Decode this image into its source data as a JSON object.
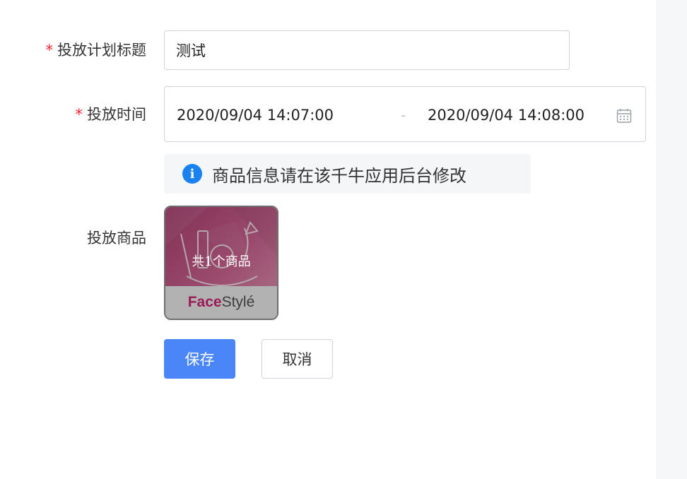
{
  "form": {
    "title_field": {
      "required_mark": "*",
      "label": "投放计划标题",
      "value": "测试"
    },
    "time_field": {
      "required_mark": "*",
      "label": "投放时间",
      "start": "2020/09/04 14:07:00",
      "separator": "-",
      "end": "2020/09/04 14:08:00"
    },
    "notice": {
      "icon_char": "i",
      "text": "商品信息请在该千牛应用后台修改"
    },
    "products_field": {
      "label": "投放商品",
      "count_text": "共1个商品",
      "brand_part1": "Face",
      "brand_part2": "Stylé"
    }
  },
  "actions": {
    "save_label": "保存",
    "cancel_label": "取消"
  },
  "icons": {
    "calendar": "calendar-icon",
    "info": "info-icon"
  },
  "colors": {
    "primary": "#4a86f7",
    "required": "#f5222d",
    "info": "#1a82f0",
    "brand": "#9c1a55",
    "border": "#cfd3da",
    "notice_bg": "#f5f6f8",
    "side_panel_bg": "#f6f7f9"
  }
}
